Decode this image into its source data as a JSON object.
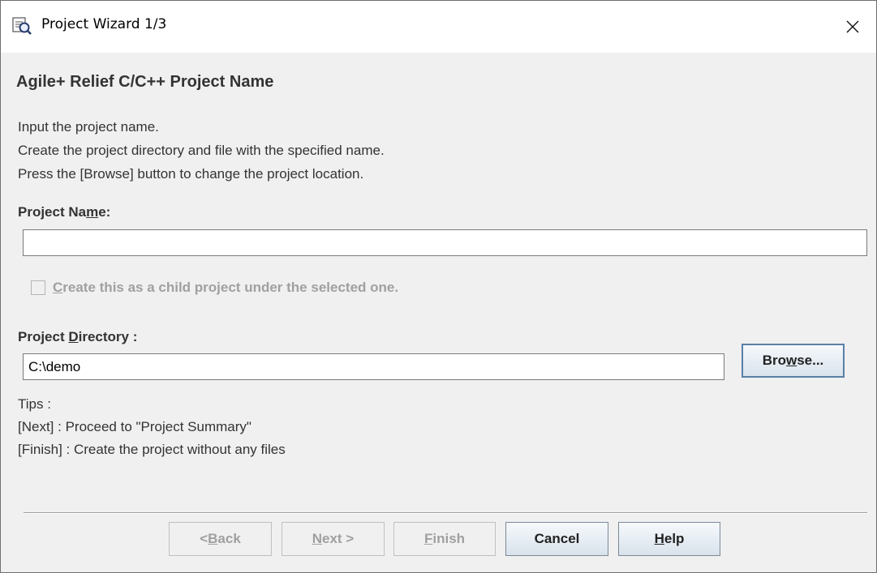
{
  "window": {
    "title": "Project Wizard 1/3",
    "app_icon": "wizard-app-icon",
    "close_icon": "close-icon"
  },
  "heading": "Agile+ Relief C/C++ Project Name",
  "description": [
    "Input the project name.",
    "Create the project directory and file with the specified name.",
    "Press the [Browse] button to change the project location."
  ],
  "project_name": {
    "label_pre": "Project Na",
    "label_mnemonic": "m",
    "label_post": "e:",
    "value": ""
  },
  "child_project": {
    "mnemonic": "C",
    "label_rest": "reate this as a child project under the selected one.",
    "checked": false,
    "enabled": false
  },
  "project_directory": {
    "label_pre": "Project ",
    "label_mnemonic": "D",
    "label_post": "irectory :",
    "value": "C:\\demo"
  },
  "browse_button": {
    "pre": "Bro",
    "mnemonic": "w",
    "post": "se..."
  },
  "tips": {
    "title": "Tips :",
    "lines": [
      "[Next] : Proceed to \"Project Summary\"",
      "[Finish] : Create the project without any files"
    ]
  },
  "buttons": {
    "back": {
      "pre": "< ",
      "mnemonic": "B",
      "post": "ack",
      "enabled": false
    },
    "next": {
      "pre": "",
      "mnemonic": "N",
      "post": "ext >",
      "enabled": false
    },
    "finish": {
      "pre": "",
      "mnemonic": "F",
      "post": "inish",
      "enabled": false
    },
    "cancel": {
      "label": "Cancel",
      "enabled": true
    },
    "help": {
      "pre": "",
      "mnemonic": "H",
      "post": "elp",
      "enabled": true
    }
  }
}
